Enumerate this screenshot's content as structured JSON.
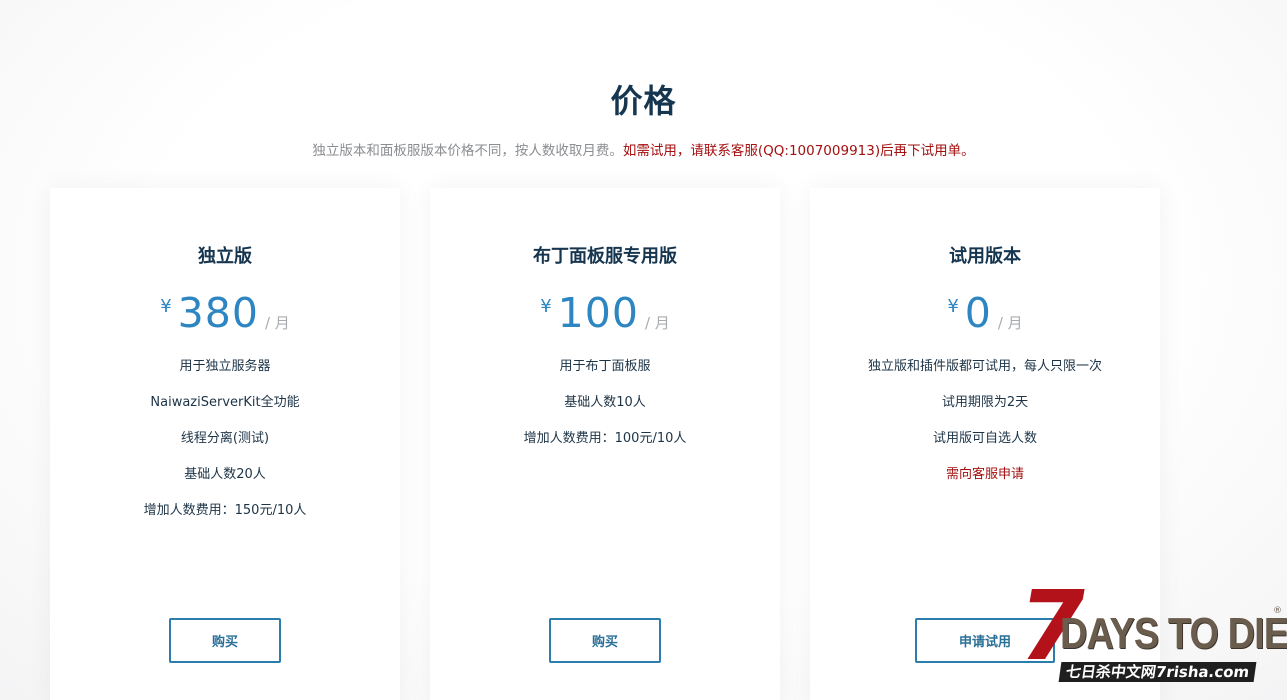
{
  "section": {
    "title": "价格",
    "subtitle_main": "独立版本和面板服版本价格不同，按人数收取月费。",
    "subtitle_warning": "如需试用，请联系客服(QQ:1007009913)后再下试用单。"
  },
  "plans": [
    {
      "name": "独立版",
      "currency": "¥",
      "amount": "380",
      "unit": "/ 月",
      "features": [
        "用于独立服务器",
        "NaiwaziServerKit全功能",
        "线程分离(测试)",
        "基础人数20人",
        "增加人数费用：150元/10人"
      ],
      "button_label": "购买"
    },
    {
      "name": "布丁面板服专用版",
      "currency": "¥",
      "amount": "100",
      "unit": "/ 月",
      "features": [
        "用于布丁面板服",
        "基础人数10人",
        "增加人数费用：100元/10人"
      ],
      "button_label": "购买"
    },
    {
      "name": "试用版本",
      "currency": "¥",
      "amount": "0",
      "unit": "/ 月",
      "features": [
        "独立版和插件版都可试用，每人只限一次",
        "试用期限为2天",
        "试用版可自选人数"
      ],
      "feature_alert": "需向客服申请",
      "button_label": "申请试用"
    }
  ],
  "watermark": {
    "seven": "7",
    "days": "DAYS TO DIE",
    "reg": "®",
    "url": "七日杀中文网7risha.com"
  },
  "colors": {
    "title": "#163650",
    "price": "#2d86c2",
    "warning": "#a40f0f",
    "button_border": "#2a7dad"
  }
}
